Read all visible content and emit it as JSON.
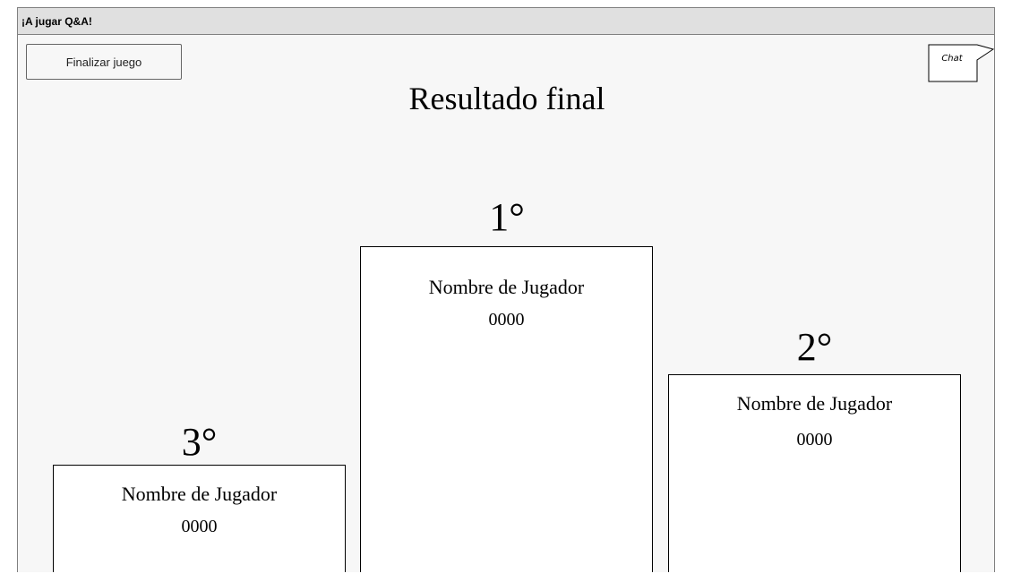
{
  "window": {
    "title": "¡A jugar Q&A!"
  },
  "toolbar": {
    "finish_label": "Finalizar juego",
    "chat_label": "Chat"
  },
  "main": {
    "title": "Resultado final"
  },
  "podium": {
    "first": {
      "rank": "1°",
      "player_name": "Nombre de Jugador",
      "score": "0000"
    },
    "second": {
      "rank": "2°",
      "player_name": "Nombre de Jugador",
      "score": "0000"
    },
    "third": {
      "rank": "3°",
      "player_name": "Nombre de Jugador",
      "score": "0000"
    }
  }
}
